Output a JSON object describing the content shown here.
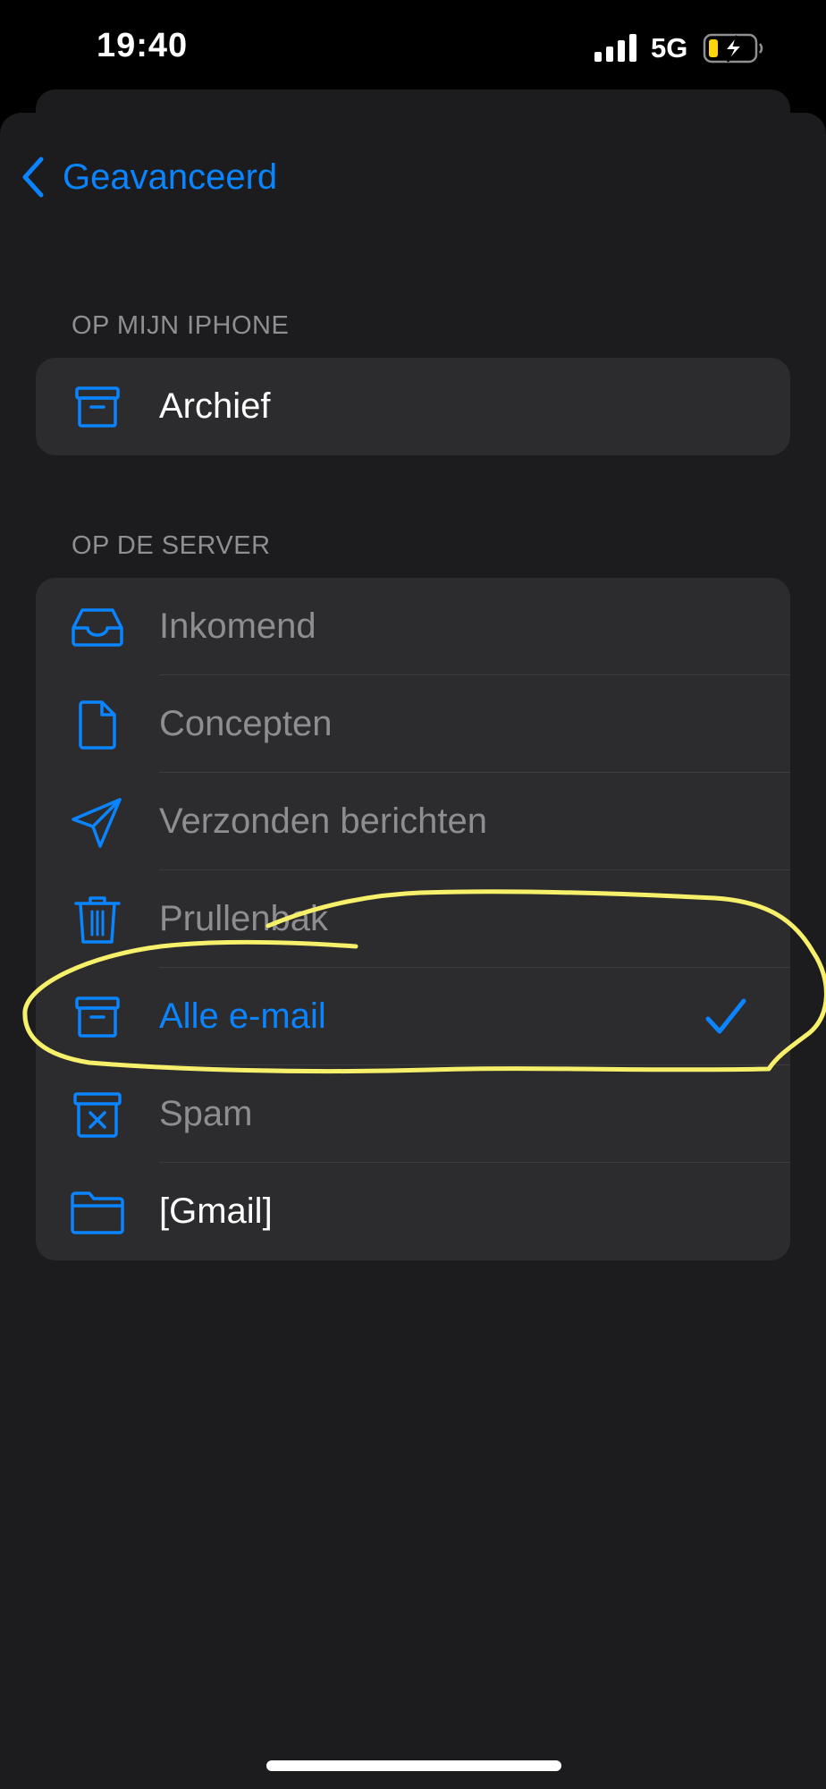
{
  "status_bar": {
    "time": "19:40",
    "network": "5G",
    "battery_charging": true,
    "battery_color": "#ffd60a"
  },
  "nav": {
    "back_label": "Geavanceerd",
    "back_icon": "chevron-left-icon"
  },
  "sections": {
    "on_iphone": {
      "header": "OP MIJN IPHONE",
      "items": [
        {
          "label": "Archief",
          "icon": "archive-box-icon",
          "style": "white"
        }
      ]
    },
    "on_server": {
      "header": "OP DE SERVER",
      "items": [
        {
          "label": "Inkomend",
          "icon": "inbox-tray-icon",
          "style": "gray"
        },
        {
          "label": "Concepten",
          "icon": "document-icon",
          "style": "gray"
        },
        {
          "label": "Verzonden berichten",
          "icon": "paper-plane-icon",
          "style": "gray"
        },
        {
          "label": "Prullenbak",
          "icon": "trash-icon",
          "style": "gray"
        },
        {
          "label": "Alle e-mail",
          "icon": "archive-box-icon",
          "style": "blue",
          "selected": true
        },
        {
          "label": "Spam",
          "icon": "junk-box-icon",
          "style": "gray"
        },
        {
          "label": "[Gmail]",
          "icon": "folder-icon",
          "style": "white"
        }
      ]
    }
  },
  "colors": {
    "accent": "#0a84ff",
    "highlight_annotation": "#f7f06a",
    "background": "#1c1c1e",
    "group_background": "#2c2c2e"
  }
}
